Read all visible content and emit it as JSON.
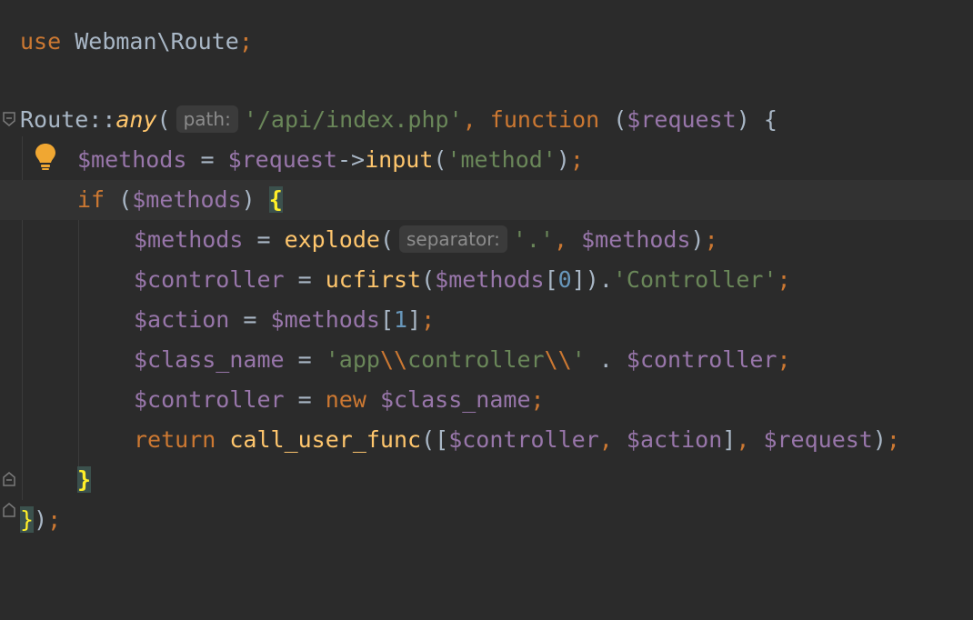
{
  "code": {
    "line1": {
      "kw": "use",
      "ns": "Webman\\Route",
      "semi": ";"
    },
    "line3": {
      "cls": "Route",
      "op": "::",
      "method": "any",
      "paren": "(",
      "hint": "path:",
      "path": "'/api/index.php'",
      "comma": ",",
      "fn_kw": "function",
      "open": " (",
      "param": "$request",
      "close": ") {"
    },
    "line4": {
      "var": "$methods",
      "eq": " = ",
      "req": "$request",
      "arrow": "->",
      "call": "input",
      "p1": "(",
      "arg": "'method'",
      "p2": ")",
      "semi": ";"
    },
    "line5": {
      "kw": "if",
      "p1": " (",
      "var": "$methods",
      "p2": ") ",
      "brace": "{"
    },
    "line6": {
      "var": "$methods",
      "eq": " = ",
      "call": "explode",
      "p1": "(",
      "hint": "separator:",
      "arg": "'.'",
      "comma": ",",
      "var2": " $methods",
      "p2": ")",
      "semi": ";"
    },
    "line7": {
      "var": "$controller",
      "eq": " = ",
      "call": "ucfirst",
      "p1": "(",
      "var2": "$methods",
      "b1": "[",
      "idx": "0",
      "b2": "])",
      "dot": ".",
      "str": "'Controller'",
      "semi": ";"
    },
    "line8": {
      "var": "$action",
      "eq": " = ",
      "var2": "$methods",
      "b1": "[",
      "idx": "1",
      "b2": "]",
      "semi": ";"
    },
    "line9": {
      "var": "$class_name",
      "eq": " = ",
      "s1": "'app",
      "e1": "\\\\",
      "s2": "controller",
      "e2": "\\\\",
      "s3": "'",
      "dot": " . ",
      "var2": "$controller",
      "semi": ";"
    },
    "line10": {
      "var": "$controller",
      "eq": " = ",
      "kw": "new",
      "var2": " $class_name",
      "semi": ";"
    },
    "line11": {
      "kw": "return",
      "call": " call_user_func",
      "p1": "([",
      "v1": "$controller",
      "c1": ",",
      "v2": " $action",
      "p2": "]",
      "c2": ",",
      "v3": " $request",
      "p3": ")",
      "semi": ";"
    },
    "line12": {
      "brace": "}"
    },
    "line13": {
      "brace": "}",
      "rest": ")",
      "semi": ";"
    }
  },
  "icons": {
    "intention_bulb": "lightbulb-icon",
    "fold": "fold-arrow-icon"
  },
  "colors": {
    "background": "#2b2b2b",
    "current_line": "#323232",
    "keyword": "#cc7832",
    "variable": "#9876aa",
    "string": "#6a8759",
    "number": "#6897bb",
    "function": "#ffc66d",
    "bulb": "#f0a732"
  }
}
